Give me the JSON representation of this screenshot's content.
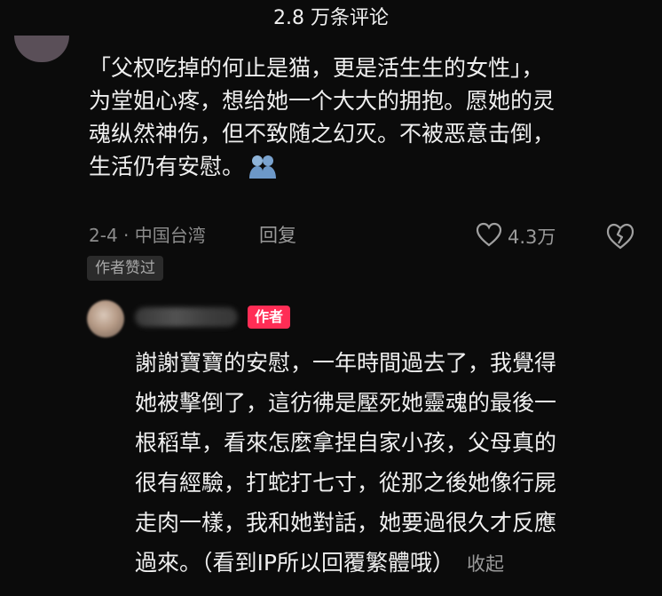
{
  "header": {
    "title": "2.8 万条评论"
  },
  "comment": {
    "lines": [
      "「父权吃掉的何止是猫，更是活生生的女性」，",
      "为堂姐心疼，想给她一个大大的拥抱。愿她的灵",
      "魂纵然神伤，但不致随之幻灭。不被恶意击倒，",
      "生活仍有安慰。"
    ],
    "emoji": "people-hug-icon",
    "date_location": "2-4 · 中国台湾",
    "reply_label": "回复",
    "like_count": "4.3万",
    "author_liked_badge": "作者赞过"
  },
  "reply": {
    "author_tag": "作者",
    "lines": [
      "謝謝寶寶的安慰，一年時間過去了，我覺得",
      "她被擊倒了，這彷彿是壓死她靈魂的最後一",
      "根稻草，看來怎麼拿捏自家小孩，父母真的",
      "很有經驗，打蛇打七寸，從那之後她像行屍",
      "走肉一樣，我和她對話，她要過很久才反應",
      "過來。（看到IP所以回覆繁體哦）"
    ],
    "collapse_label": "收起"
  },
  "colors": {
    "background": "#0b0b0b",
    "text": "#efefef",
    "muted": "#9a9a9a",
    "author_tag": "#ff2d55"
  }
}
